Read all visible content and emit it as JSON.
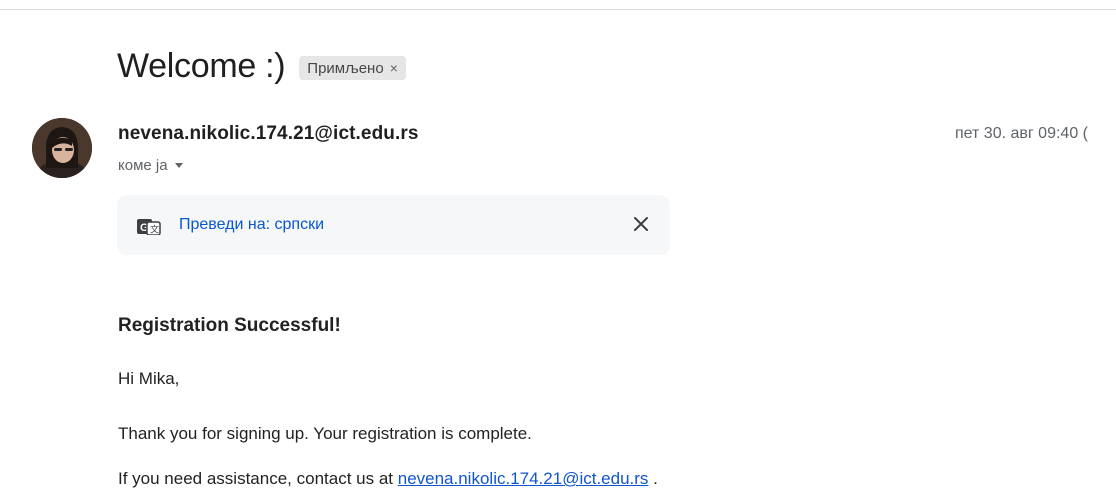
{
  "email": {
    "subject": "Welcome :)",
    "label": {
      "text": "Примљено",
      "remove": "×"
    },
    "sender": "nevena.nikolic.174.21@ict.edu.rs",
    "recipient": "коме ја",
    "date": "пет 30. авг 09:40 (",
    "translate": {
      "link": "Преведи на: српски",
      "icon": "google-translate-icon",
      "close_icon": "close-icon"
    },
    "body": {
      "heading": "Registration Successful!",
      "greeting": "Hi Mika,",
      "thanks": "Thank you for signing up. Your registration is complete.",
      "assist_prefix": "If you need assistance, contact us at",
      "assist_link": "nevena.nikolic.174.21@ict.edu.rs",
      "assist_suffix": "."
    }
  },
  "colors": {
    "link": "#0b57d0",
    "body_link": "#1155cc",
    "chip_bg": "#e6e6e6",
    "translate_bg": "#f5f7f9"
  }
}
